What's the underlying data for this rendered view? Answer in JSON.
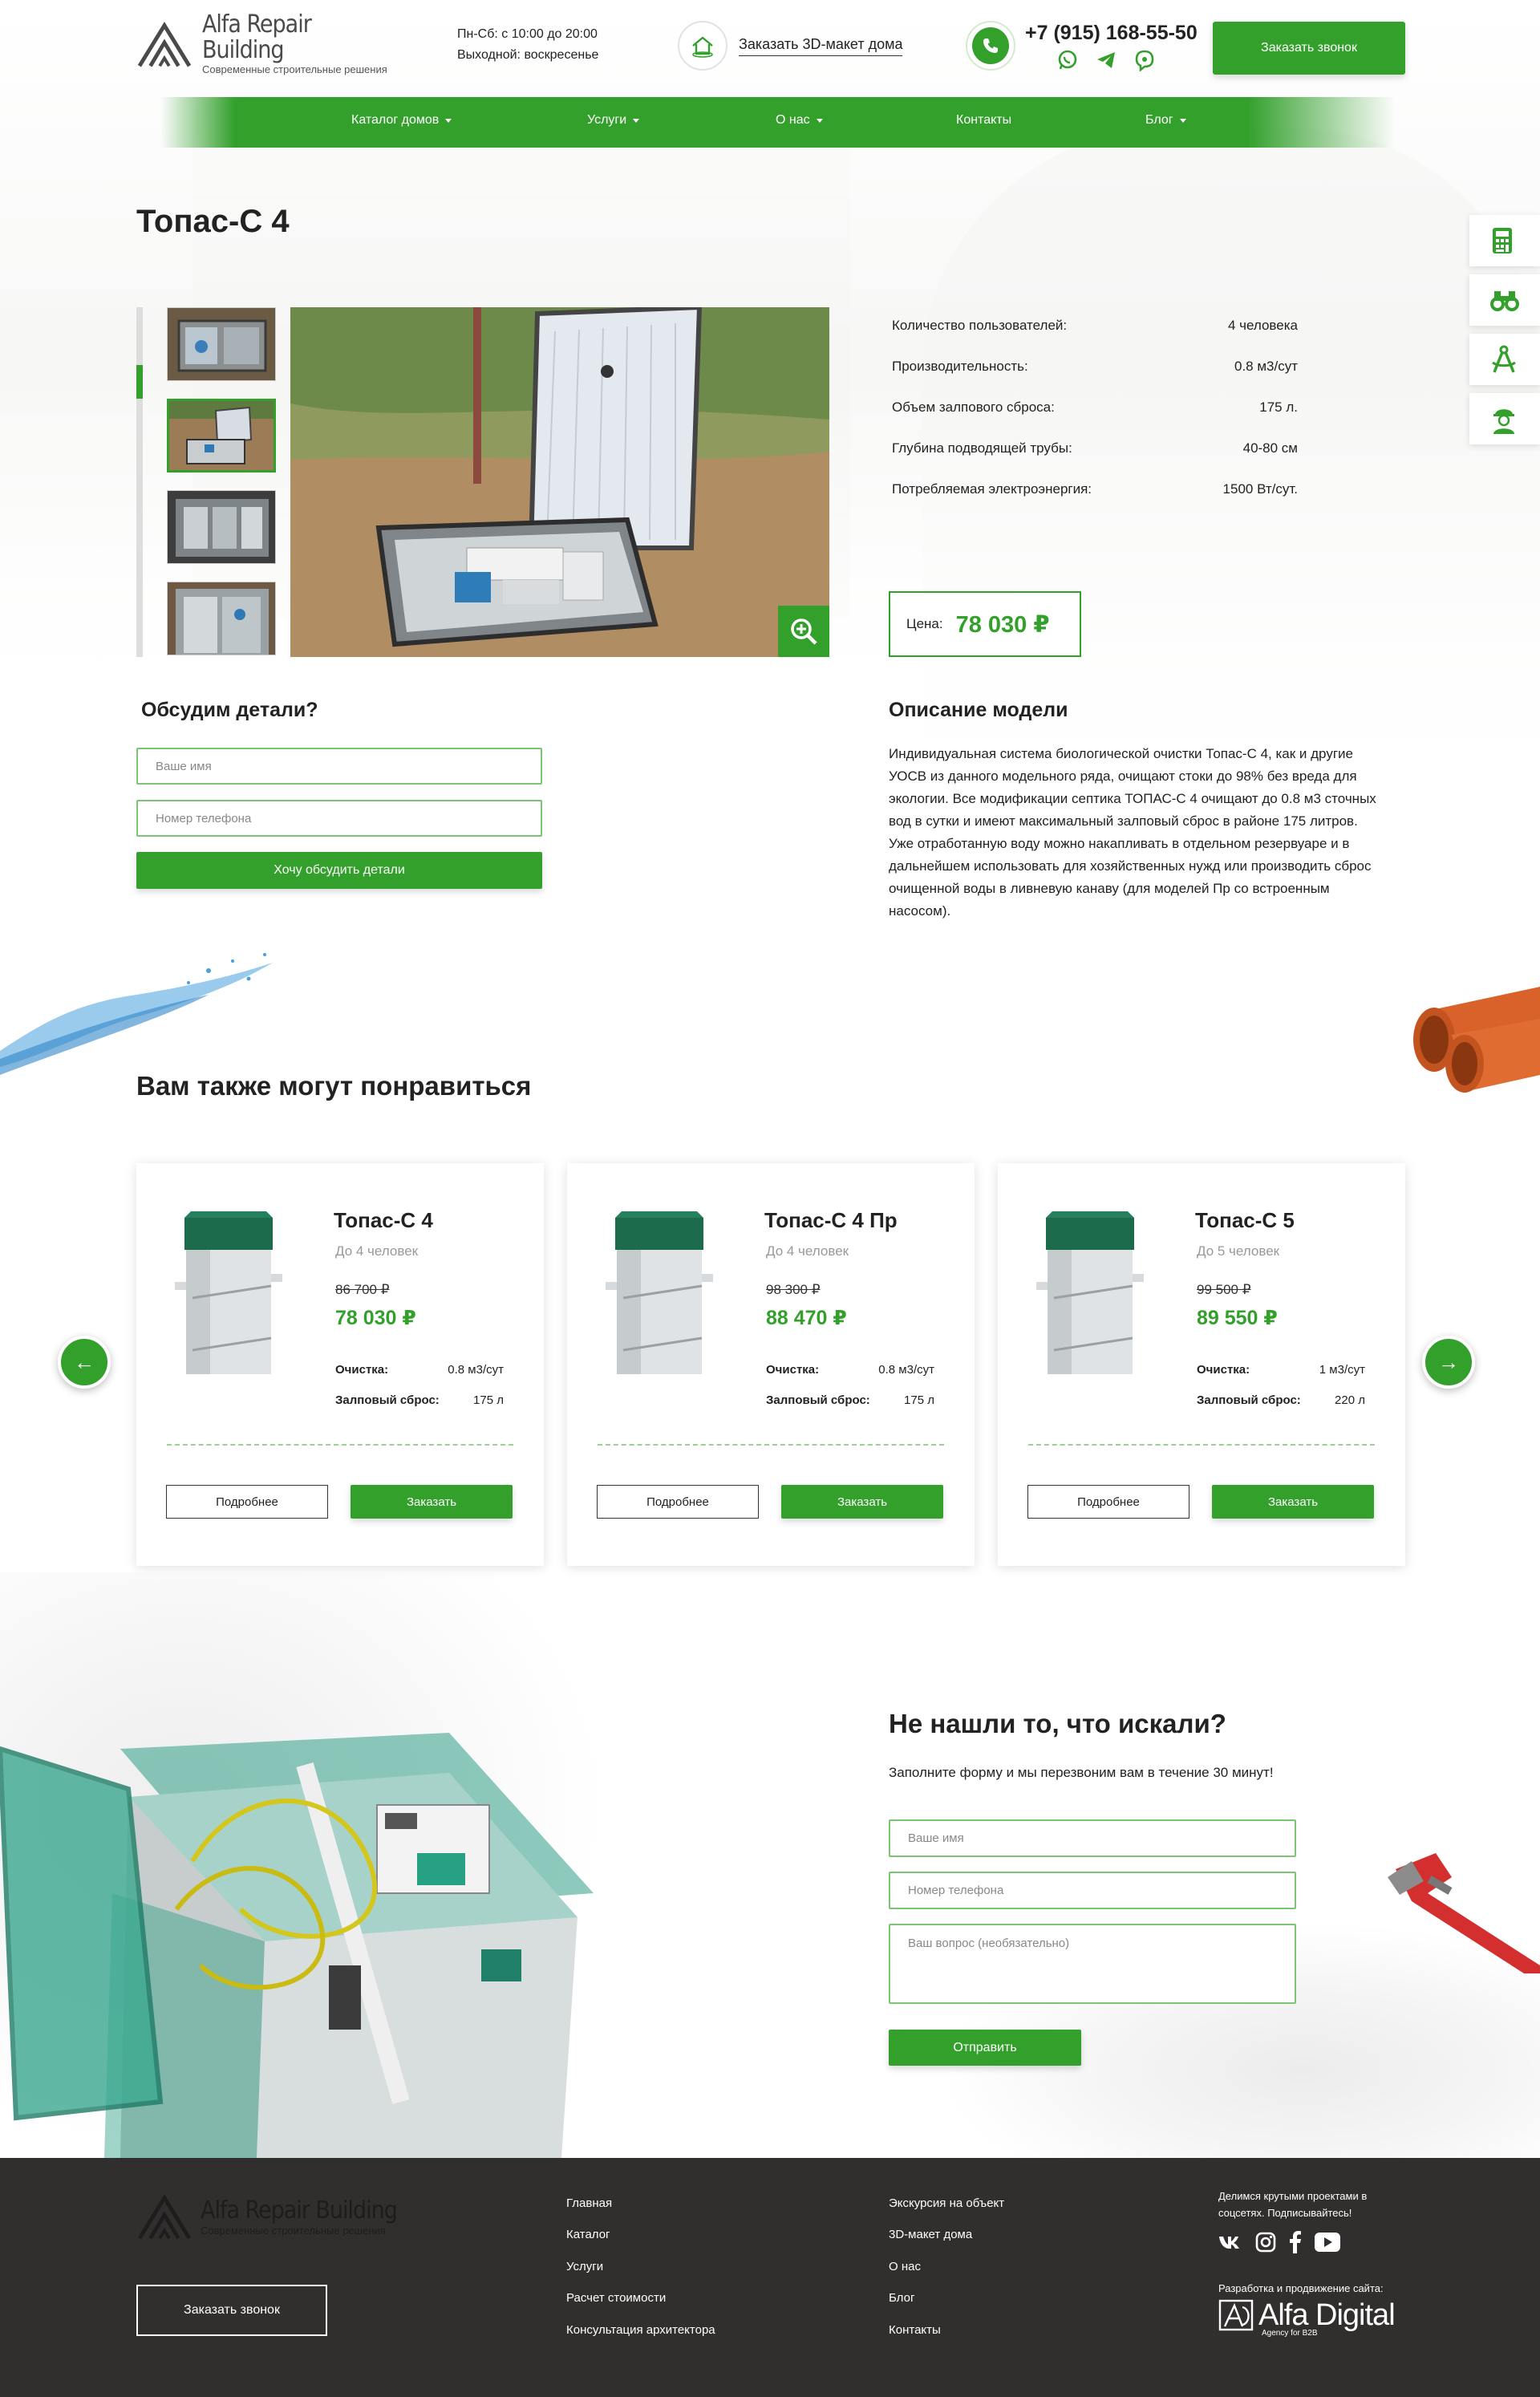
{
  "header": {
    "logo_title": "Alfa Repair Building",
    "logo_subtitle": "Современные строительные решения",
    "hours_line1": "Пн-Сб: с 10:00 до 20:00",
    "hours_line2": "Выходной: воскресенье",
    "model_link": "Заказать 3D-макет дома",
    "phone": "+7 (915) 168-55-50",
    "callback_button": "Заказать звонок"
  },
  "nav": {
    "items": [
      {
        "label": "Каталог домов",
        "dropdown": true
      },
      {
        "label": "Услуги",
        "dropdown": true
      },
      {
        "label": "О нас",
        "dropdown": true
      },
      {
        "label": "Контакты",
        "dropdown": false
      },
      {
        "label": "Блог",
        "dropdown": true
      }
    ]
  },
  "side_tools": [
    "calculator-icon",
    "binoculars-icon",
    "drafting-compass-icon",
    "builder-icon"
  ],
  "product": {
    "title": "Топас-С 4",
    "specs": [
      {
        "label": "Количество пользователей:",
        "value": "4 человека"
      },
      {
        "label": "Производительность:",
        "value": "0.8 м3/сут"
      },
      {
        "label": "Объем залпового сброса:",
        "value": "175 л."
      },
      {
        "label": "Глубина подводящей трубы:",
        "value": "40-80 см"
      },
      {
        "label": "Потребляемая электроэнергия:",
        "value": "1500 Вт/сут."
      }
    ],
    "price_label": "Цена:",
    "price": "78 030 ₽",
    "description_title": "Описание модели",
    "description": "Индивидуальная система биологической очистки Топас-С 4, как и другие УОСВ из данного модельного ряда, очищают стоки до 98% без вреда для экологии. Все модификации септика ТОПАС-С 4 очищают до 0.8 м3 сточных вод в сутки и имеют максимальный залповый сброс в районе 175 литров. Уже отработанную воду можно накапливать в отдельном резервуаре и в дальнейшем использовать для хозяйственных нужд или производить сброс очищенной воды в ливневую канаву (для моделей Пр со встроенным насосом)."
  },
  "discuss_form": {
    "title": "Обсудим детали?",
    "name_placeholder": "Ваше имя",
    "phone_placeholder": "Номер телефона",
    "submit": "Хочу обсудить детали"
  },
  "recommendations": {
    "title": "Вам также могут понравиться",
    "cards": [
      {
        "name": "Топас-С 4",
        "capacity": "До 4 человек",
        "old_price": "86 700 ₽",
        "price": "78 030 ₽",
        "clean_label": "Очистка:",
        "clean_value": "0.8 м3/сут",
        "salvo_label": "Залповый сброс:",
        "salvo_value": "175 л",
        "more": "Подробнее",
        "order": "Заказать"
      },
      {
        "name": "Топас-С 4 Пр",
        "capacity": "До 4 человек",
        "old_price": "98 300 ₽",
        "price": "88 470 ₽",
        "clean_label": "Очистка:",
        "clean_value": "0.8 м3/сут",
        "salvo_label": "Залповый сброс:",
        "salvo_value": "175 л",
        "more": "Подробнее",
        "order": "Заказать"
      },
      {
        "name": "Топас-С 5",
        "capacity": "До 5 человек",
        "old_price": "99 500 ₽",
        "price": "89 550 ₽",
        "clean_label": "Очистка:",
        "clean_value": "1 м3/сут",
        "salvo_label": "Залповый сброс:",
        "salvo_value": "220 л",
        "more": "Подробнее",
        "order": "Заказать"
      }
    ],
    "prev_arrow": "←",
    "next_arrow": "→"
  },
  "not_found_form": {
    "title": "Не нашли то, что искали?",
    "subtitle": "Заполните форму и мы перезвоним вам в течение 30 минут!",
    "name_placeholder": "Ваше имя",
    "phone_placeholder": "Номер телефона",
    "question_placeholder": "Ваш вопрос  (необязательно)",
    "submit": "Отправить"
  },
  "footer": {
    "logo_title": "Alfa Repair Building",
    "logo_subtitle": "Современные строительные решения",
    "callback_button": "Заказать звонок",
    "col1": [
      "Главная",
      "Каталог",
      "Услуги",
      "Расчет стоимости",
      "Консультация архитектора"
    ],
    "col2": [
      "Экскурсия на объект",
      "3D-макет дома",
      "О нас",
      "Блог",
      "Контакты"
    ],
    "social_note": "Делимся крутыми проектами в соцсетях. Подписывайтесь!",
    "socials": [
      "vk-icon",
      "instagram-icon",
      "facebook-icon",
      "youtube-icon"
    ],
    "dev_note": "Разработка и продвижение сайта:",
    "dev_logo_title": "Alfa Digital",
    "dev_logo_sub": "Agency for B2B"
  },
  "colors": {
    "accent": "#33a02c",
    "footer_bg": "#312e2e",
    "tank_green": "#1d6b4d"
  }
}
